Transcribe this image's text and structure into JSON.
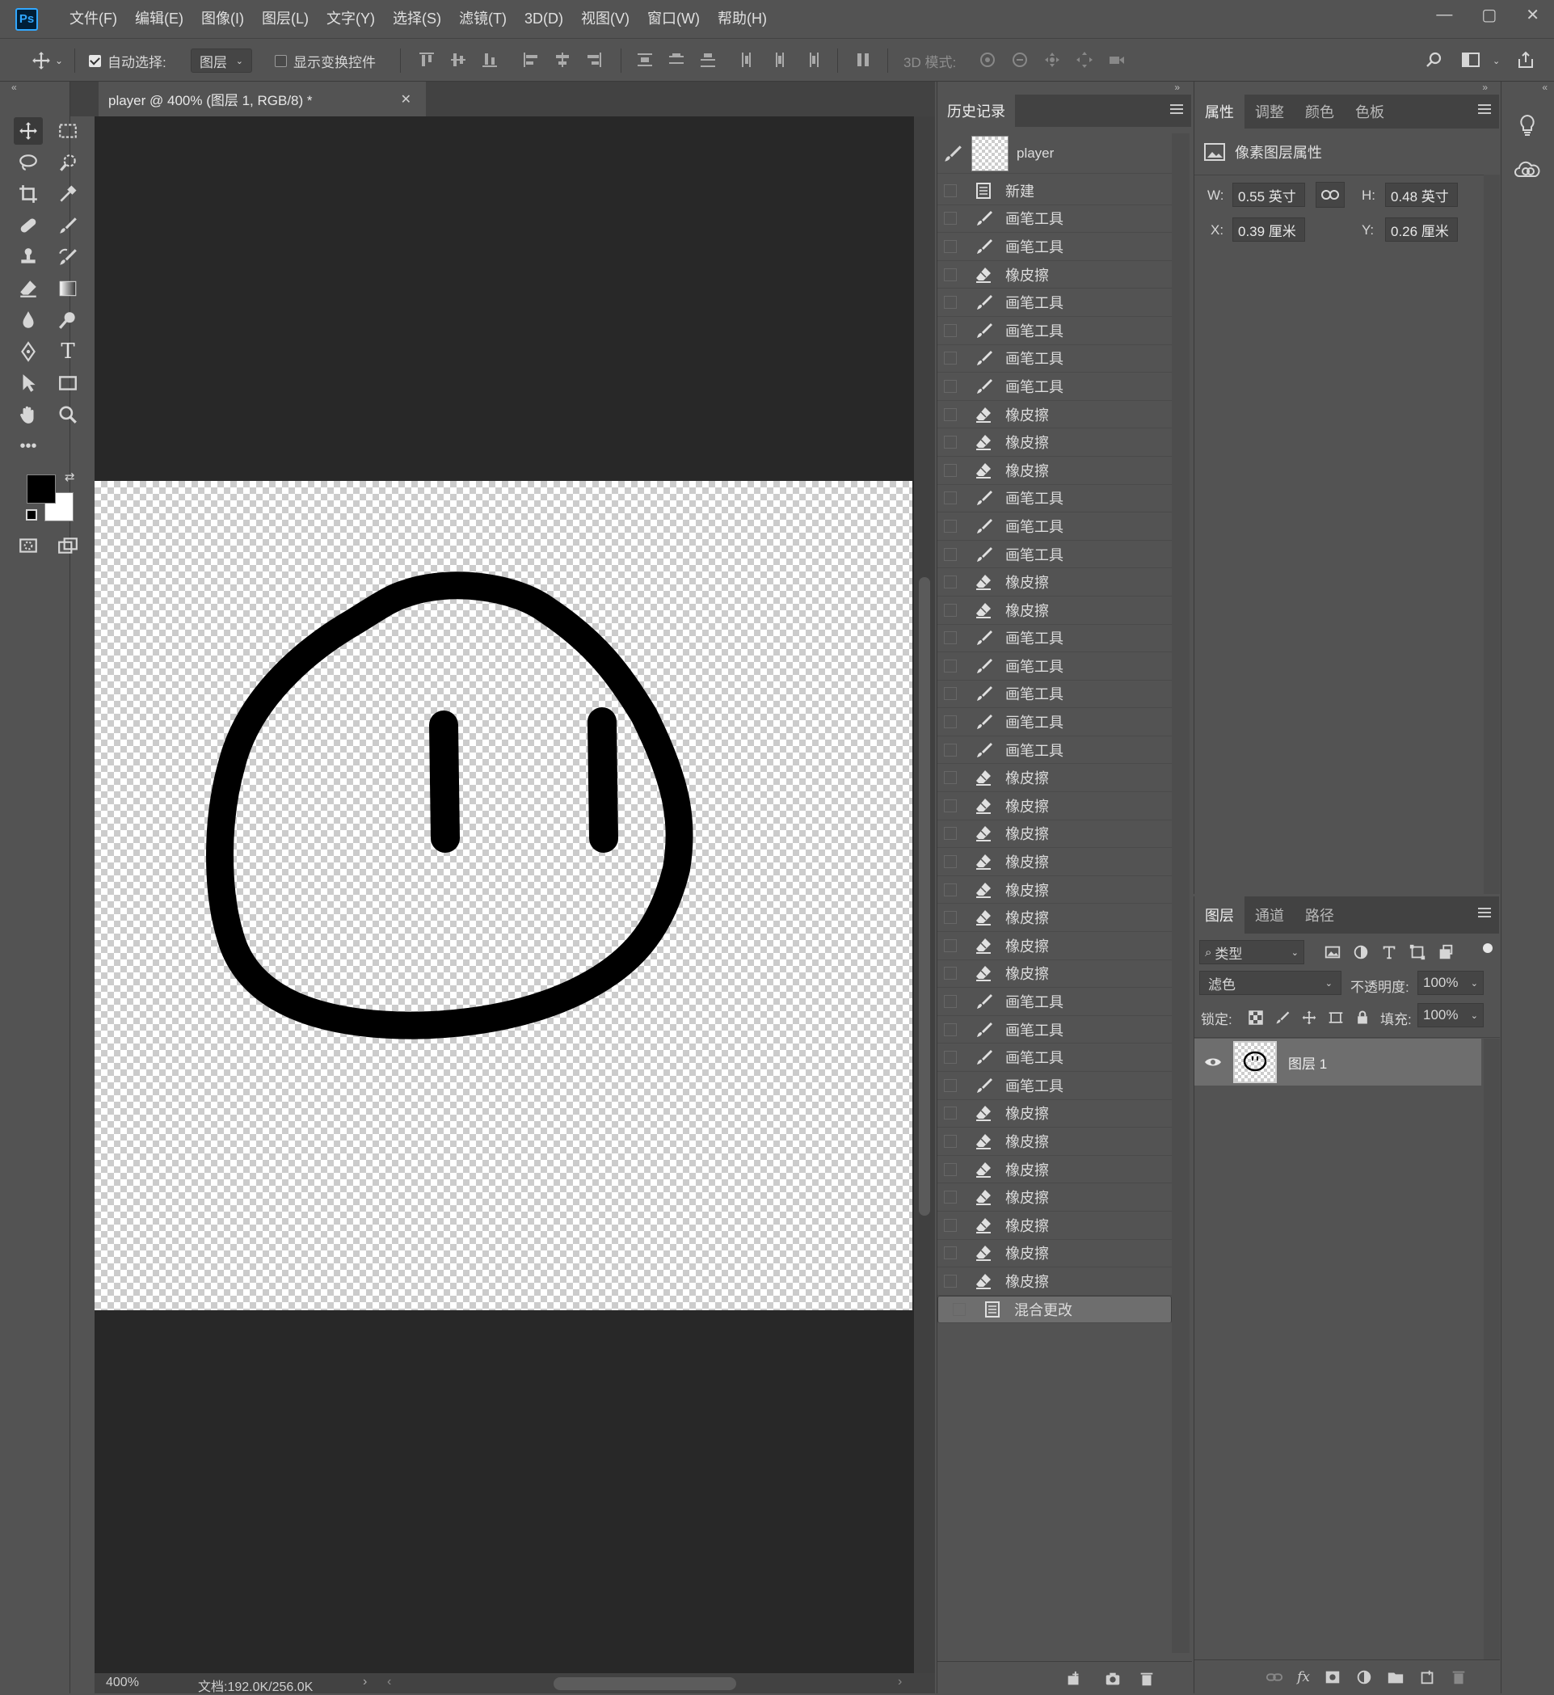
{
  "app": {
    "logo": "Ps"
  },
  "menu": [
    "文件(F)",
    "编辑(E)",
    "图像(I)",
    "图层(L)",
    "文字(Y)",
    "选择(S)",
    "滤镜(T)",
    "3D(D)",
    "视图(V)",
    "窗口(W)",
    "帮助(H)"
  ],
  "options": {
    "auto_select_label": "自动选择:",
    "auto_select_checked": true,
    "auto_select_target": "图层",
    "show_transform_label": "显示变换控件",
    "show_transform_checked": false,
    "mode_3d_label": "3D 模式:"
  },
  "document": {
    "tab_title": "player @ 400% (图层 1, RGB/8) *",
    "zoom": "400%",
    "doc_size": "文档:192.0K/256.0K"
  },
  "history": {
    "tab": "历史记录",
    "snapshot_name": "player",
    "items": [
      {
        "label": "新建",
        "icon": "doc-icon"
      },
      {
        "label": "画笔工具",
        "icon": "brush-icon"
      },
      {
        "label": "画笔工具",
        "icon": "brush-icon"
      },
      {
        "label": "橡皮擦",
        "icon": "eraser-icon"
      },
      {
        "label": "画笔工具",
        "icon": "brush-icon"
      },
      {
        "label": "画笔工具",
        "icon": "brush-icon"
      },
      {
        "label": "画笔工具",
        "icon": "brush-icon"
      },
      {
        "label": "画笔工具",
        "icon": "brush-icon"
      },
      {
        "label": "橡皮擦",
        "icon": "eraser-icon"
      },
      {
        "label": "橡皮擦",
        "icon": "eraser-icon"
      },
      {
        "label": "橡皮擦",
        "icon": "eraser-icon"
      },
      {
        "label": "画笔工具",
        "icon": "brush-icon"
      },
      {
        "label": "画笔工具",
        "icon": "brush-icon"
      },
      {
        "label": "画笔工具",
        "icon": "brush-icon"
      },
      {
        "label": "橡皮擦",
        "icon": "eraser-icon"
      },
      {
        "label": "橡皮擦",
        "icon": "eraser-icon"
      },
      {
        "label": "画笔工具",
        "icon": "brush-icon"
      },
      {
        "label": "画笔工具",
        "icon": "brush-icon"
      },
      {
        "label": "画笔工具",
        "icon": "brush-icon"
      },
      {
        "label": "画笔工具",
        "icon": "brush-icon"
      },
      {
        "label": "画笔工具",
        "icon": "brush-icon"
      },
      {
        "label": "橡皮擦",
        "icon": "eraser-icon"
      },
      {
        "label": "橡皮擦",
        "icon": "eraser-icon"
      },
      {
        "label": "橡皮擦",
        "icon": "eraser-icon"
      },
      {
        "label": "橡皮擦",
        "icon": "eraser-icon"
      },
      {
        "label": "橡皮擦",
        "icon": "eraser-icon"
      },
      {
        "label": "橡皮擦",
        "icon": "eraser-icon"
      },
      {
        "label": "橡皮擦",
        "icon": "eraser-icon"
      },
      {
        "label": "橡皮擦",
        "icon": "eraser-icon"
      },
      {
        "label": "画笔工具",
        "icon": "brush-icon"
      },
      {
        "label": "画笔工具",
        "icon": "brush-icon"
      },
      {
        "label": "画笔工具",
        "icon": "brush-icon"
      },
      {
        "label": "画笔工具",
        "icon": "brush-icon"
      },
      {
        "label": "橡皮擦",
        "icon": "eraser-icon"
      },
      {
        "label": "橡皮擦",
        "icon": "eraser-icon"
      },
      {
        "label": "橡皮擦",
        "icon": "eraser-icon"
      },
      {
        "label": "橡皮擦",
        "icon": "eraser-icon"
      },
      {
        "label": "橡皮擦",
        "icon": "eraser-icon"
      },
      {
        "label": "橡皮擦",
        "icon": "eraser-icon"
      },
      {
        "label": "橡皮擦",
        "icon": "eraser-icon"
      },
      {
        "label": "混合更改",
        "icon": "doc-icon",
        "selected": true
      }
    ]
  },
  "properties": {
    "tabs": [
      "属性",
      "调整",
      "颜色",
      "色板"
    ],
    "title": "像素图层属性",
    "w_label": "W:",
    "w_value": "0.55 英寸",
    "h_label": "H:",
    "h_value": "0.48 英寸",
    "x_label": "X:",
    "x_value": "0.39 厘米",
    "y_label": "Y:",
    "y_value": "0.26 厘米"
  },
  "layers": {
    "tabs": [
      "图层",
      "通道",
      "路径"
    ],
    "filter_label": "类型",
    "blend_mode": "滤色",
    "opacity_label": "不透明度:",
    "opacity_value": "100%",
    "lock_label": "锁定:",
    "fill_label": "填充:",
    "fill_value": "100%",
    "items": [
      {
        "name": "图层 1",
        "visible": true,
        "selected": true
      }
    ]
  },
  "colors": {
    "foreground": "#000000",
    "background": "#ffffff",
    "accent": "#31a8ff"
  }
}
